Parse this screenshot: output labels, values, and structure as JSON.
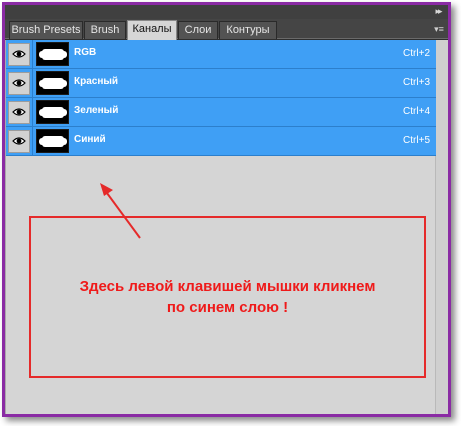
{
  "tabs": [
    {
      "label": "Brush Presets",
      "active": false
    },
    {
      "label": "Brush",
      "active": false
    },
    {
      "label": "Каналы",
      "active": true
    },
    {
      "label": "Слои",
      "active": false
    },
    {
      "label": "Контуры",
      "active": false
    }
  ],
  "collapse_icon": "double-chevron-right-icon",
  "panel_menu_icon": "panel-menu-icon",
  "channels": [
    {
      "name": "RGB",
      "shortcut": "Ctrl+2"
    },
    {
      "name": "Красный",
      "shortcut": "Ctrl+3"
    },
    {
      "name": "Зеленый",
      "shortcut": "Ctrl+4"
    },
    {
      "name": "Синий",
      "shortcut": "Ctrl+5"
    }
  ],
  "annotation": {
    "line1": "Здесь левой клавишей мышки кликнем",
    "line2": "по синем слою !"
  },
  "colors": {
    "frame": "#8a2ba4",
    "selected_row": "#3f9ff5",
    "annotation": "#e52a2a",
    "active_tab": "#d6d6d6"
  }
}
